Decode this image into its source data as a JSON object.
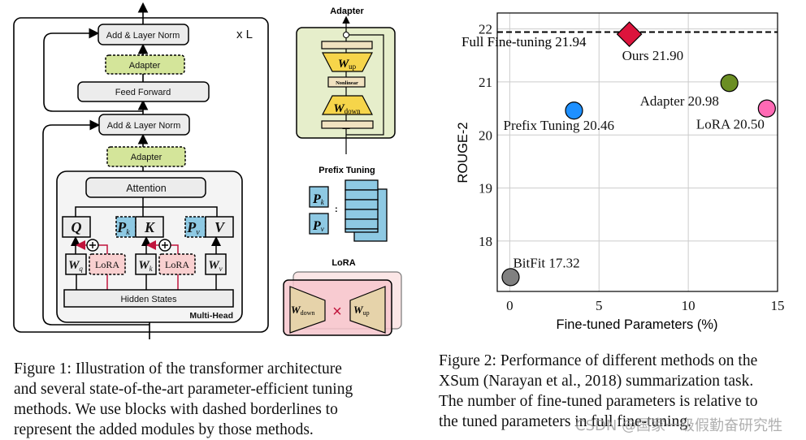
{
  "figure1": {
    "repeat_label": "x L",
    "add_layer_norm": "Add & Layer Norm",
    "adapter": "Adapter",
    "feed_forward": "Feed Forward",
    "attention": "Attention",
    "multi_head": "Multi-Head",
    "hidden_states": "Hidden States",
    "q": "Q",
    "k": "K",
    "v": "V",
    "p": "P",
    "p_k_sub": "k",
    "p_v_sub": "v",
    "w": "W",
    "w_q_sub": "q",
    "w_k_sub": "k",
    "w_v_sub": "v",
    "lora": "LoRA",
    "adapter_panel": {
      "title": "Adapter",
      "w": "W",
      "up_sub": "up",
      "down_sub": "down",
      "nonlinear": "Nonlinear"
    },
    "prefix_panel": {
      "title": "Prefix Tuning",
      "colon": ":"
    },
    "lora_panel": {
      "title": "LoRA",
      "times": "×"
    },
    "colors": {
      "adapter": "#d4e59a",
      "prefix": "#8ec9e3",
      "lora": "#f9d0d0",
      "block": "#ececec"
    }
  },
  "chart_data": {
    "type": "scatter",
    "title": "",
    "xlabel": "Fine-tuned Parameters (%)",
    "ylabel": "ROUGE-2",
    "xlim": [
      -0.7,
      15
    ],
    "ylim": [
      17.05,
      22.3
    ],
    "xticks": [
      "0",
      "5",
      "10",
      "15"
    ],
    "yticks": [
      "18",
      "19",
      "20",
      "21",
      "22"
    ],
    "grid": true,
    "reference_line": {
      "label": "Full Fine-tuning 21.94",
      "y": 21.94,
      "style": "dashed"
    },
    "points": [
      {
        "label": "BitFit 17.32",
        "x": 0.05,
        "y": 17.32,
        "marker": "circle",
        "color": "#808080"
      },
      {
        "label": "Prefix Tuning 20.46",
        "x": 3.6,
        "y": 20.46,
        "marker": "circle",
        "color": "#1e90ff"
      },
      {
        "label": "Ours 21.90",
        "x": 6.7,
        "y": 21.9,
        "marker": "diamond",
        "color": "#dc143c"
      },
      {
        "label": "Adapter 20.98",
        "x": 12.3,
        "y": 20.98,
        "marker": "circle",
        "color": "#6b8e23"
      },
      {
        "label": "LoRA 20.50",
        "x": 14.4,
        "y": 20.5,
        "marker": "circle",
        "color": "#ff69b4"
      }
    ]
  },
  "captions": {
    "figure1": [
      "Figure 1:  Illustration of the transformer architecture",
      "and several state-of-the-art parameter-efficient tuning",
      "methods.  We use blocks with dashed borderlines to",
      "represent the added modules by those methods."
    ],
    "figure2": [
      "Figure 2: Performance of different methods on the",
      "XSum (Narayan et al., 2018) summarization task.",
      "The number of fine-tuned parameters is relative to",
      "the tuned parameters in full fine-tuning."
    ]
  },
  "watermark": "CSDN @国家一级假勤奋研究牲"
}
